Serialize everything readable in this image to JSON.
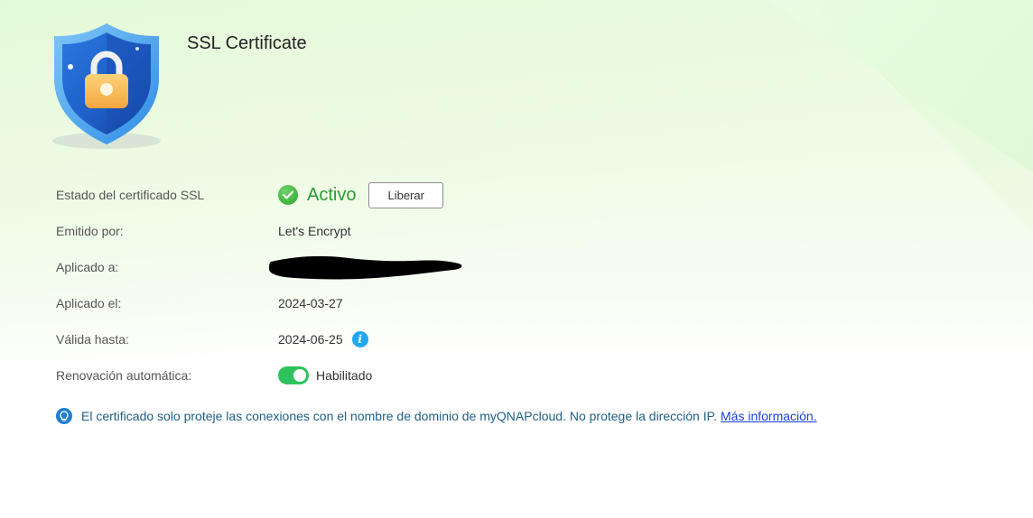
{
  "header": {
    "title": "SSL Certificate",
    "icon": "shield-lock-icon"
  },
  "details": {
    "status": {
      "label": "Estado del certificado SSL",
      "value": "Activo",
      "button_label": "Liberar",
      "color": "#2e9b2e"
    },
    "issued_by": {
      "label": "Emitido por:",
      "value": "Let's Encrypt"
    },
    "applied_to": {
      "label": "Aplicado a:"
    },
    "applied_on": {
      "label": "Aplicado el:",
      "value": "2024-03-27"
    },
    "valid_until": {
      "label": "Válida hasta:",
      "value": "2024-06-25",
      "info_icon": "info-icon"
    },
    "auto_renew": {
      "label": "Renovación automática:",
      "value": "Habilitado",
      "enabled": true
    }
  },
  "note": {
    "text": "El certificado solo proteje las conexiones con el nombre de dominio de myQNAPcloud. No protege la dirección IP.",
    "link": "Más información."
  }
}
